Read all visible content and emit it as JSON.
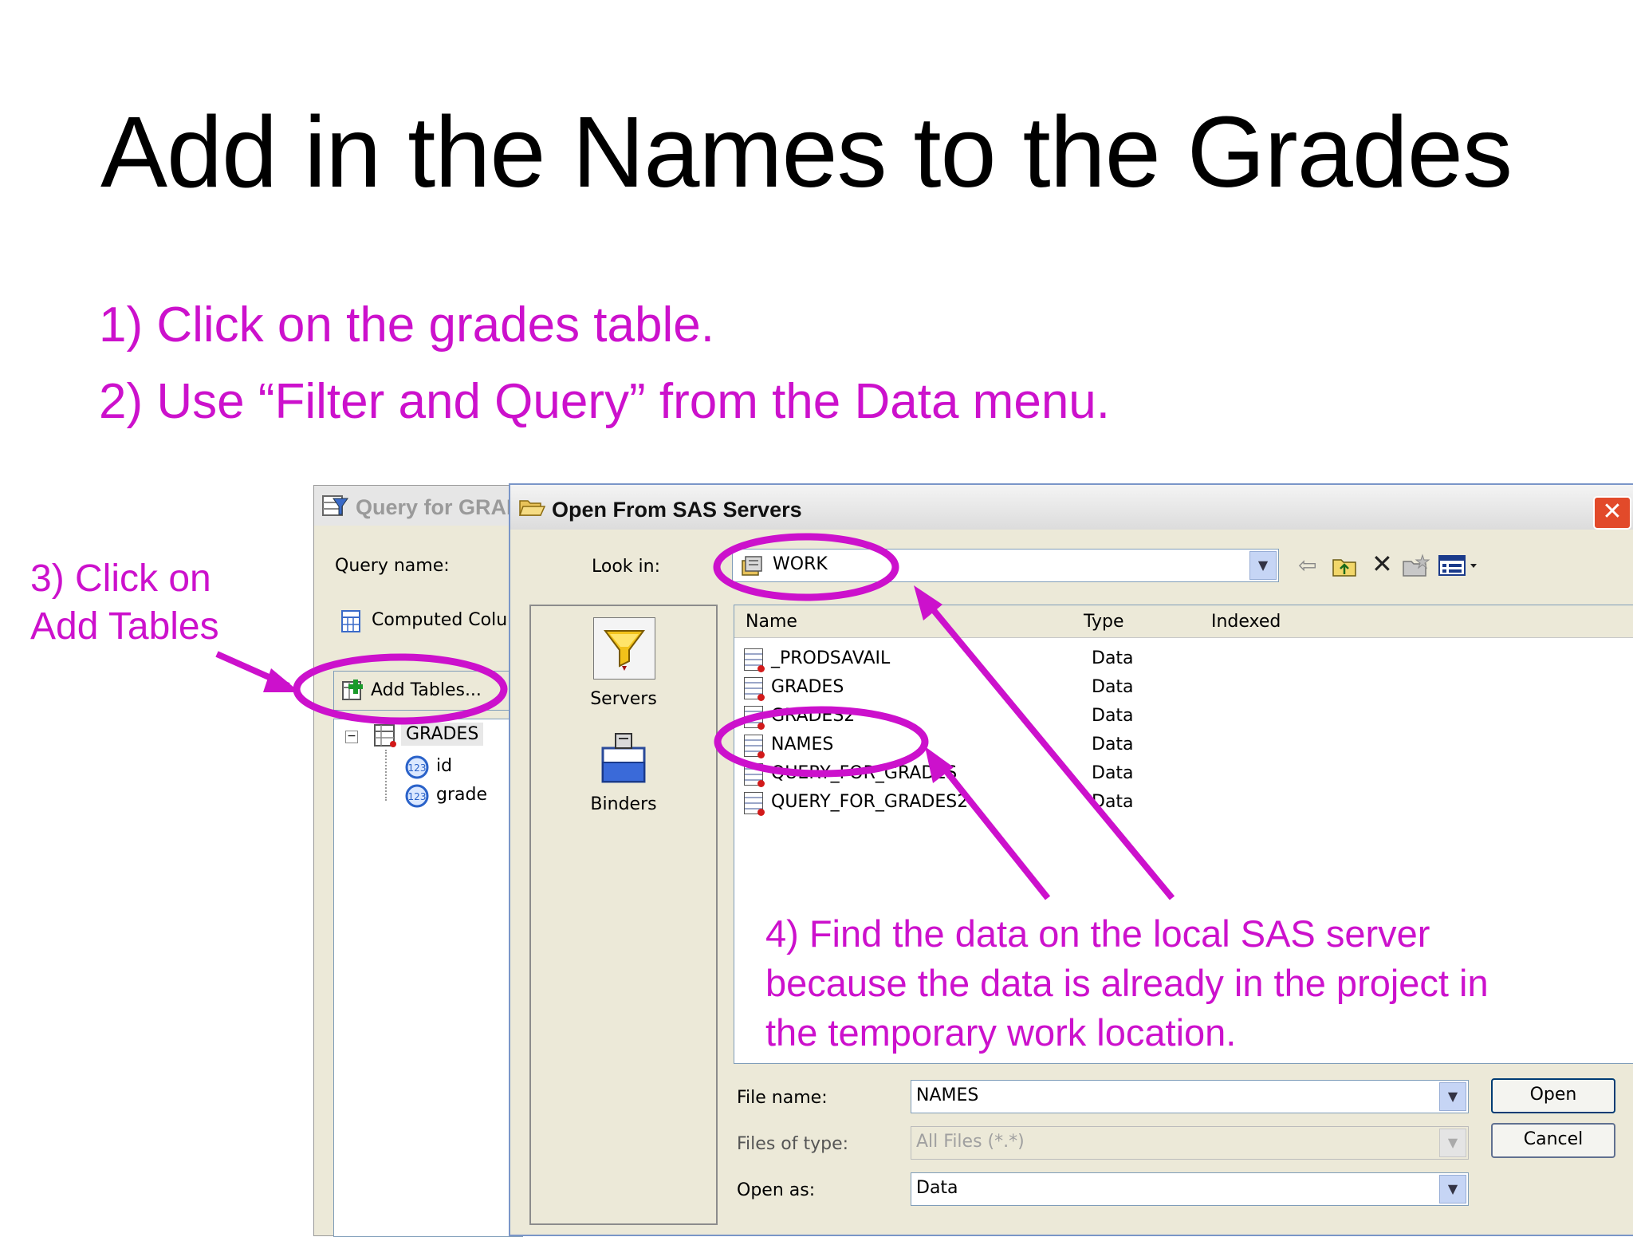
{
  "slide": {
    "title": "Add in the Names to the Grades",
    "step1": "1) Click on the grades table.",
    "step2": "2) Use “Filter and Query” from the Data menu.",
    "note3_line1": "3) Click on",
    "note3_line2": "Add Tables",
    "note4_line1": "4) Find the data on the local SAS server",
    "note4_line2": "because the data is already in the project in",
    "note4_line3": "the temporary work location."
  },
  "query_window": {
    "title": "Query for GRAI",
    "query_name_label": "Query name:",
    "computed_columns_label": "Computed Colum",
    "add_tables_label": "Add Tables...",
    "tree": {
      "table": "GRADES",
      "columns": [
        "id",
        "grade"
      ]
    }
  },
  "open_dialog": {
    "title": "Open From SAS Servers",
    "look_in_label": "Look in:",
    "look_in_value": "WORK",
    "places": [
      {
        "label": "Servers",
        "icon": "funnel-icon"
      },
      {
        "label": "Binders",
        "icon": "binder-icon"
      }
    ],
    "columns": [
      "Name",
      "Type",
      "Indexed"
    ],
    "files": [
      {
        "name": "_PRODSAVAIL",
        "type": "Data"
      },
      {
        "name": "GRADES",
        "type": "Data"
      },
      {
        "name": "GRADES2",
        "type": "Data"
      },
      {
        "name": "NAMES",
        "type": "Data"
      },
      {
        "name": "QUERY_FOR_GRADES",
        "type": "Data"
      },
      {
        "name": "QUERY_FOR_GRADES2",
        "type": "Data"
      }
    ],
    "file_name_label": "File name:",
    "file_name_value": "NAMES",
    "files_of_type_label": "Files of type:",
    "files_of_type_value": "All Files (*.*)",
    "open_as_label": "Open as:",
    "open_as_value": "Data",
    "open_button": "Open",
    "cancel_button": "Cancel",
    "close_glyph": "✕"
  },
  "colors": {
    "annotation": "#cc11cc",
    "dialog_face": "#ece9d8",
    "field_border": "#7f9db9"
  }
}
